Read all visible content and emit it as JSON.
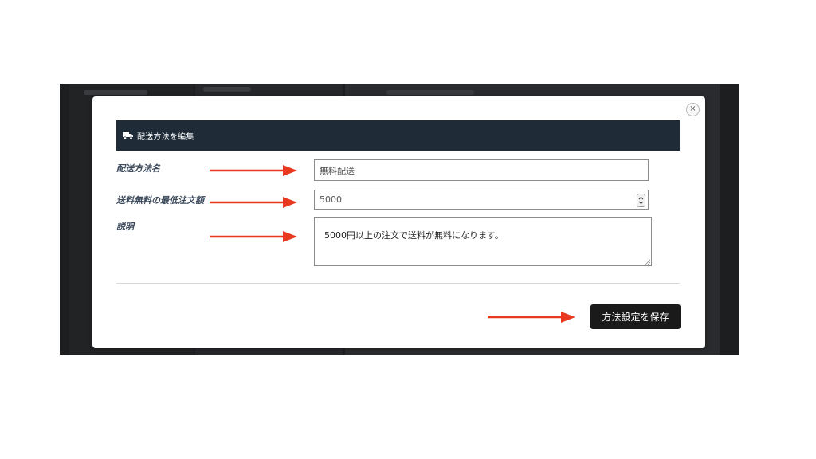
{
  "modal": {
    "close_symbol": "×",
    "header": {
      "icon": "truck-icon",
      "title": "配送方法を編集"
    },
    "fields": {
      "name": {
        "label": "配送方法名",
        "value": "無料配送"
      },
      "min_order": {
        "label": "送料無料の最低注文額",
        "value": "5000",
        "spinner_icon": "⌃⌄"
      },
      "description": {
        "label": "説明",
        "value": "5000円以上の注文で送料が無料になります。"
      }
    },
    "save_button_label": "方法設定を保存"
  },
  "annotations": {
    "arrow_color": "#e8391e"
  },
  "colors": {
    "header_bg": "#1f2c38",
    "button_bg": "#1a1a1a",
    "backdrop": "#1d1e20"
  }
}
